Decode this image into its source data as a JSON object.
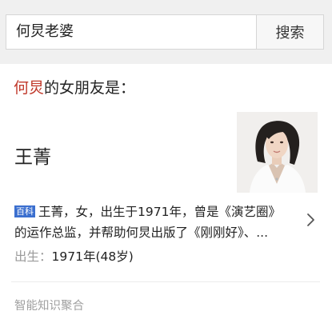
{
  "search": {
    "query": "何炅老婆",
    "button_label": "搜索"
  },
  "answer": {
    "subject": "何炅",
    "question_suffix": "的女朋友是：",
    "name": "王菁"
  },
  "summary": {
    "badge": "百科",
    "line1": "王菁，女，出生于1971年，曾是《演艺圈》",
    "line2": "的运作总监，并帮助何炅出版了《刚刚好》、..."
  },
  "birth": {
    "label": "出生：",
    "value": "1971年(48岁)"
  },
  "footer": {
    "label": "智能知识聚合"
  },
  "colors": {
    "highlight": "#c0392b",
    "badge": "#3b6fcf"
  }
}
